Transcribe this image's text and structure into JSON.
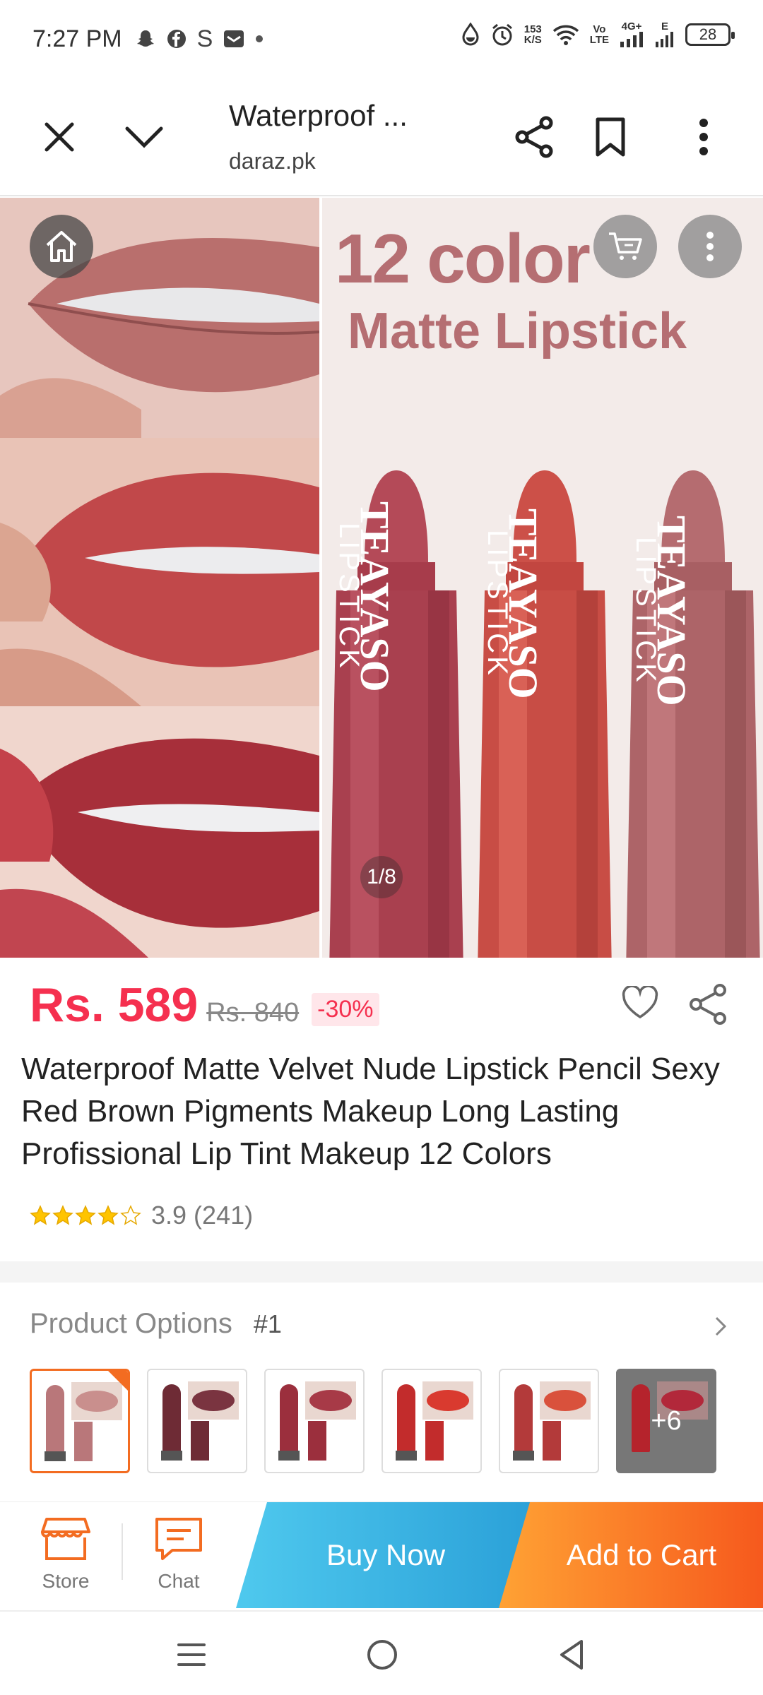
{
  "status_bar": {
    "time": "7:27 PM",
    "net_speed_top": "153",
    "net_speed_bottom": "K/S",
    "volte_top": "Vo",
    "volte_bottom": "LTE",
    "network": "4G+",
    "network2": "E",
    "battery": "28",
    "icons": [
      "snapchat-icon",
      "facebook-icon",
      "s-icon",
      "mail-icon",
      "dot-icon",
      "water-drop-icon",
      "alarm-icon",
      "wifi-icon",
      "signal-icon"
    ]
  },
  "browser": {
    "page_title": "Waterproof ...",
    "url": "daraz.pk"
  },
  "hero": {
    "promo_line1": "12 color",
    "promo_line2": "Matte Lipstick",
    "brand": "TEAYASO",
    "brand_sub": "LIPSTICK",
    "counter": "1/8"
  },
  "price": {
    "current": "Rs. 589",
    "original": "Rs. 840",
    "discount": "-30%"
  },
  "product": {
    "title": "Waterproof Matte Velvet Nude Lipstick Pencil Sexy Red Brown Pigments Makeup Long Lasting Profissional Lip Tint Makeup 12 Colors",
    "rating": 3.9,
    "rating_text": "3.9",
    "rating_count": "(241)"
  },
  "options": {
    "label": "Product Options",
    "selected": "#1",
    "more_label": "+6",
    "swatches": [
      {
        "stick": "#b9777a",
        "lip": "#c98f8d"
      },
      {
        "stick": "#6e2b35",
        "lip": "#7a3440"
      },
      {
        "stick": "#9b2f3d",
        "lip": "#a73a47"
      },
      {
        "stick": "#c22c2c",
        "lip": "#d93a2f"
      },
      {
        "stick": "#b33a3a",
        "lip": "#d9513c"
      }
    ]
  },
  "action_bar": {
    "store_label": "Store",
    "chat_label": "Chat",
    "buy_now": "Buy Now",
    "add_to_cart": "Add to Cart"
  },
  "colors": {
    "price_red": "#f5304f",
    "daraz_orange": "#f36c21",
    "buy_blue": "#2aa0d8"
  }
}
